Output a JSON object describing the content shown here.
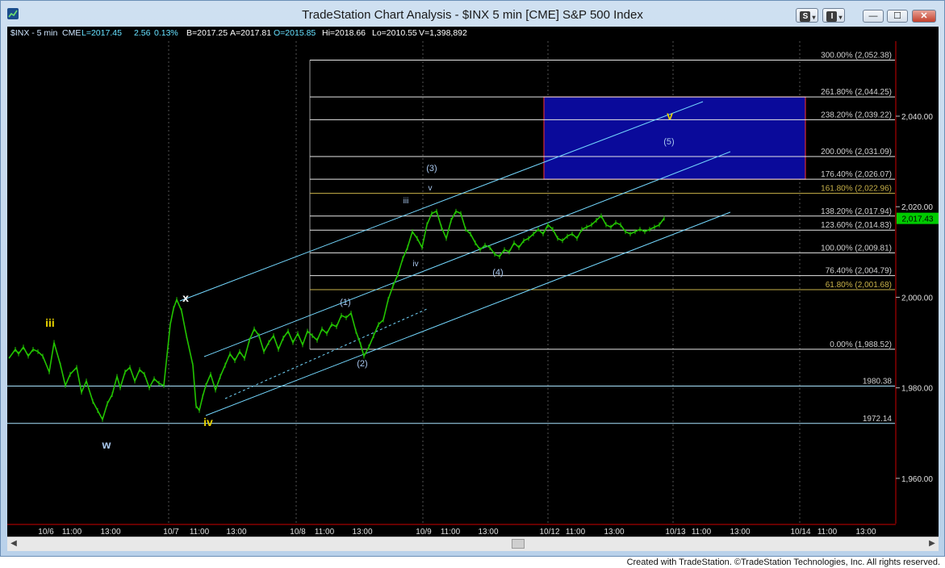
{
  "window": {
    "title": "TradeStation Chart Analysis - $INX 5 min [CME] S&P 500 Index",
    "s_button": "S",
    "i_button": "I",
    "min_label": "—",
    "max_label": "☐",
    "close_label": "✕"
  },
  "header": {
    "symbol": "$INX - 5 min",
    "exchange": "CME",
    "last": "L=2017.45",
    "change": "2.56",
    "pct": "0.13%",
    "bid": "B=2017.25",
    "ask": "A=2017.81",
    "open": "O=2015.85",
    "high": "Hi=2018.66",
    "low": "Lo=2010.55",
    "volume": "V=1,398,892"
  },
  "colors": {
    "background": "#000000",
    "price_bars": "#22c400",
    "fib_lines": "#e6e6e6",
    "fib_gold": "#c9b24a",
    "channel": "#74d8ff",
    "target_box": "#0a0a9a",
    "wave_yellow": "#e5d000",
    "wave_blue": "#a8c7ee",
    "last_price_tag": "#00cc00",
    "axis_red": "#cc0000"
  },
  "chart_data": {
    "type": "line",
    "series": [
      {
        "x": [
          0,
          8,
          12,
          18,
          24,
          30,
          36,
          42,
          50,
          56,
          64,
          70,
          76,
          84,
          90,
          96,
          104,
          110,
          116,
          122,
          128,
          134,
          138,
          144,
          150,
          156,
          162,
          168,
          174,
          180,
          186,
          192,
          200,
          204,
          208,
          214,
          220,
          228,
          232,
          236,
          240,
          244,
          250,
          256,
          262,
          268,
          274,
          280,
          286,
          292,
          298,
          304,
          310,
          316,
          322,
          328,
          334,
          340,
          346,
          352,
          358,
          364,
          370,
          376,
          382,
          388,
          394,
          400,
          406,
          412,
          418,
          424,
          430,
          436,
          440,
          446,
          452,
          458,
          464,
          470,
          476,
          482,
          488,
          494,
          500,
          506,
          512,
          518,
          524,
          530,
          536,
          542,
          548,
          554,
          560,
          566,
          572,
          578,
          584,
          590,
          596,
          602,
          608,
          614,
          620,
          626,
          632,
          638,
          644,
          650,
          656,
          662,
          668,
          674,
          680,
          686,
          692,
          698,
          704,
          710,
          716,
          722,
          728,
          734,
          740,
          746,
          752,
          758,
          764,
          770,
          776,
          782,
          788,
          794,
          800,
          806,
          812
        ],
        "y": [
          1986.5,
          1988.5,
          1987.5,
          1989.0,
          1987.0,
          1988.5,
          1988.0,
          1987.0,
          1983.5,
          1990.0,
          1985.0,
          1980.5,
          1983.0,
          1984.5,
          1979.0,
          1981.5,
          1977.0,
          1975.0,
          1973.0,
          1976.5,
          1978.5,
          1982.5,
          1980.0,
          1983.5,
          1984.5,
          1981.5,
          1984.0,
          1983.0,
          1980.0,
          1982.0,
          1981.0,
          1980.5,
          1994.0,
          1997.5,
          1999.5,
          1997.0,
          1991.5,
          1985.0,
          1976.0,
          1975.0,
          1978.0,
          1980.5,
          1983.0,
          1979.5,
          1982.5,
          1985.0,
          1987.5,
          1986.0,
          1988.0,
          1986.5,
          1990.5,
          1993.0,
          1991.5,
          1988.0,
          1990.0,
          1991.5,
          1988.5,
          1991.0,
          1992.5,
          1990.0,
          1992.0,
          1989.5,
          1992.5,
          1991.5,
          1990.5,
          1993.0,
          1992.0,
          1994.0,
          1993.5,
          1996.0,
          1995.5,
          1996.5,
          1992.5,
          1989.5,
          1987.0,
          1989.0,
          1991.5,
          1994.0,
          1995.0,
          1999.5,
          2002.5,
          2005.0,
          2008.5,
          2011.0,
          2014.5,
          2013.0,
          2011.0,
          2016.0,
          2018.5,
          2019.0,
          2015.5,
          2013.0,
          2017.0,
          2019.0,
          2018.5,
          2015.0,
          2014.0,
          2012.0,
          2010.5,
          2011.5,
          2011.0,
          2009.5,
          2009.0,
          2010.5,
          2010.0,
          2012.0,
          2011.0,
          2012.5,
          2013.0,
          2014.0,
          2015.0,
          2014.0,
          2016.0,
          2015.0,
          2013.0,
          2012.5,
          2013.5,
          2014.0,
          2013.0,
          2015.0,
          2015.5,
          2016.0,
          2017.0,
          2018.0,
          2016.0,
          2015.5,
          2016.5,
          2016.0,
          2014.5,
          2014.0,
          2014.5,
          2015.0,
          2014.5,
          2015.0,
          2015.5,
          2016.0,
          2017.45
        ]
      }
    ],
    "ylim": [
      1950.0,
      2058.0
    ],
    "y_ticks": [
      "1,960.00",
      "1,980.00",
      "2,000.00",
      "2,020.00",
      "2,040.00"
    ],
    "x_ticks": [
      "10/6",
      "11:00",
      "13:00",
      "10/7",
      "11:00",
      "13:00",
      "10/8",
      "11:00",
      "13:00",
      "10/9",
      "11:00",
      "13:00",
      "10/12",
      "11:00",
      "13:00",
      "10/13",
      "11:00",
      "13:00",
      "10/14",
      "11:00",
      "13:00"
    ],
    "fibonacci": [
      {
        "label": "300.00% (2,052.38)",
        "value": 2052.38,
        "gold": false
      },
      {
        "label": "261.80% (2,044.25)",
        "value": 2044.25,
        "gold": false
      },
      {
        "label": "238.20% (2,039.22)",
        "value": 2039.22,
        "gold": false
      },
      {
        "label": "200.00% (2,031.09)",
        "value": 2031.09,
        "gold": false
      },
      {
        "label": "176.40% (2,026.07)",
        "value": 2026.07,
        "gold": false
      },
      {
        "label": "161.80% (2,022.96)",
        "value": 2022.96,
        "gold": true
      },
      {
        "label": "138.20% (2,017.94)",
        "value": 2017.94,
        "gold": false
      },
      {
        "label": "123.60% (2,014.83)",
        "value": 2014.83,
        "gold": false
      },
      {
        "label": "100.00% (2,009.81)",
        "value": 2009.81,
        "gold": false
      },
      {
        "label": "76.40% (2,004.79)",
        "value": 2004.79,
        "gold": false
      },
      {
        "label": "61.80% (2,001.68)",
        "value": 2001.68,
        "gold": true
      },
      {
        "label": "0.00% (1,988.52)",
        "value": 1988.52,
        "gold": false
      }
    ],
    "horizontal_lines": [
      {
        "label": "1980.38",
        "value": 1980.38
      },
      {
        "label": "1972.14",
        "value": 1972.14
      }
    ],
    "last_price": "2,017.43",
    "target_zone": [
      2026.07,
      2044.25
    ],
    "wave_labels": [
      {
        "text": "iii",
        "color": "yellow"
      },
      {
        "text": "w",
        "color": "blue"
      },
      {
        "text": "x",
        "color": "white"
      },
      {
        "text": "iv",
        "color": "yellow"
      },
      {
        "text": "(1)",
        "color": "blue"
      },
      {
        "text": "(2)",
        "color": "blue"
      },
      {
        "text": "iii",
        "color": "blue"
      },
      {
        "text": "iv",
        "color": "blue"
      },
      {
        "text": "v",
        "color": "blue"
      },
      {
        "text": "(3)",
        "color": "blue"
      },
      {
        "text": "(4)",
        "color": "blue"
      },
      {
        "text": "v",
        "color": "yellow"
      },
      {
        "text": "(5)",
        "color": "blue"
      }
    ]
  },
  "footer": {
    "credit": "Created with TradeStation. ©TradeStation Technologies, Inc. All rights reserved."
  }
}
